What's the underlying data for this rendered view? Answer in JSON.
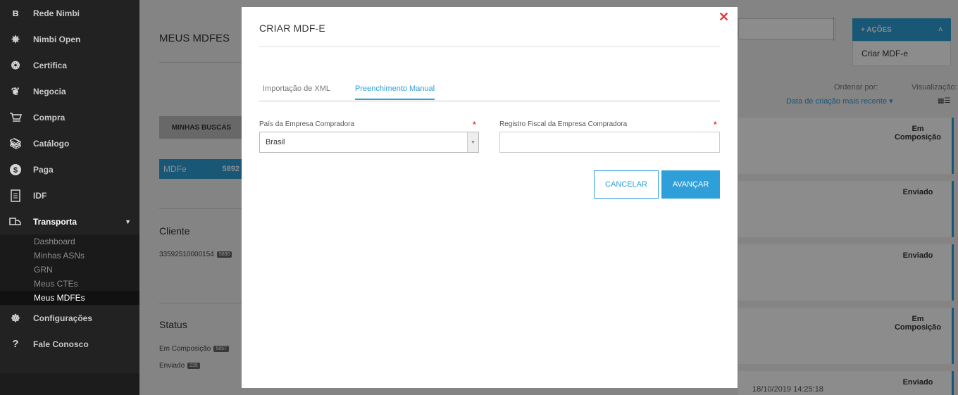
{
  "sidebar": {
    "items": [
      {
        "label": "Rede Nimbi",
        "icon": "nimbi-logo-icon"
      },
      {
        "label": "Nimbi Open",
        "icon": "nimbi-open-icon"
      },
      {
        "label": "Certifica",
        "icon": "certifica-icon"
      },
      {
        "label": "Negocia",
        "icon": "handshake-icon"
      },
      {
        "label": "Compra",
        "icon": "cart-icon"
      },
      {
        "label": "Catálogo",
        "icon": "catalog-icon"
      },
      {
        "label": "Paga",
        "icon": "dollar-icon"
      },
      {
        "label": "IDF",
        "icon": "document-icon"
      },
      {
        "label": "Transporta",
        "icon": "truck-icon"
      }
    ],
    "sub_items": [
      "Dashboard",
      "Minhas ASNs",
      "GRN",
      "Meus CTEs",
      "Meus MDFEs"
    ],
    "bottom_items": [
      {
        "label": "Configurações",
        "icon": "settings-icon"
      },
      {
        "label": "Fale Conosco",
        "icon": "help-icon"
      }
    ]
  },
  "page": {
    "title": "MEUS MDFES",
    "searches_button": "MINHAS BUSCAS",
    "mdfe_tag": {
      "label": "MDFe",
      "count": "5892"
    },
    "cliente": {
      "heading": "Cliente",
      "value": "33592510000154",
      "count": "5890"
    },
    "status": {
      "heading": "Status",
      "items": [
        {
          "label": "Em Composição",
          "count": "5657"
        },
        {
          "label": "Enviado",
          "count": "235"
        }
      ]
    },
    "acoes_button": "+ AÇÕES",
    "acoes_menu_item": "Criar MDF-e",
    "sort_label": "Ordenar por:",
    "sort_value": "Data de criação mais recente",
    "view_label": "Visualização:",
    "cards": [
      {
        "status": "Em Composição",
        "date": ""
      },
      {
        "status": "Enviado",
        "date": ""
      },
      {
        "status": "Enviado",
        "date": ""
      },
      {
        "status": "Em Composição",
        "date": ""
      },
      {
        "status": "Enviado",
        "date": "18/10/2019 14:25:18"
      }
    ]
  },
  "modal": {
    "title": "CRIAR MDF-E",
    "tabs": [
      {
        "label": "Importação de XML",
        "active": false
      },
      {
        "label": "Preenchimento Manual",
        "active": true
      }
    ],
    "country_label": "País da Empresa Compradora",
    "country_value": "Brasil",
    "fiscal_label": "Registro Fiscal da Empresa Compradora",
    "fiscal_value": "",
    "cancel_button": "CANCELAR",
    "next_button": "AVANÇAR",
    "close_glyph": "✕",
    "required_mark": "*"
  },
  "colors": {
    "accent": "#2e9fd8",
    "danger": "#e03b3b",
    "sidebar": "#222222"
  }
}
